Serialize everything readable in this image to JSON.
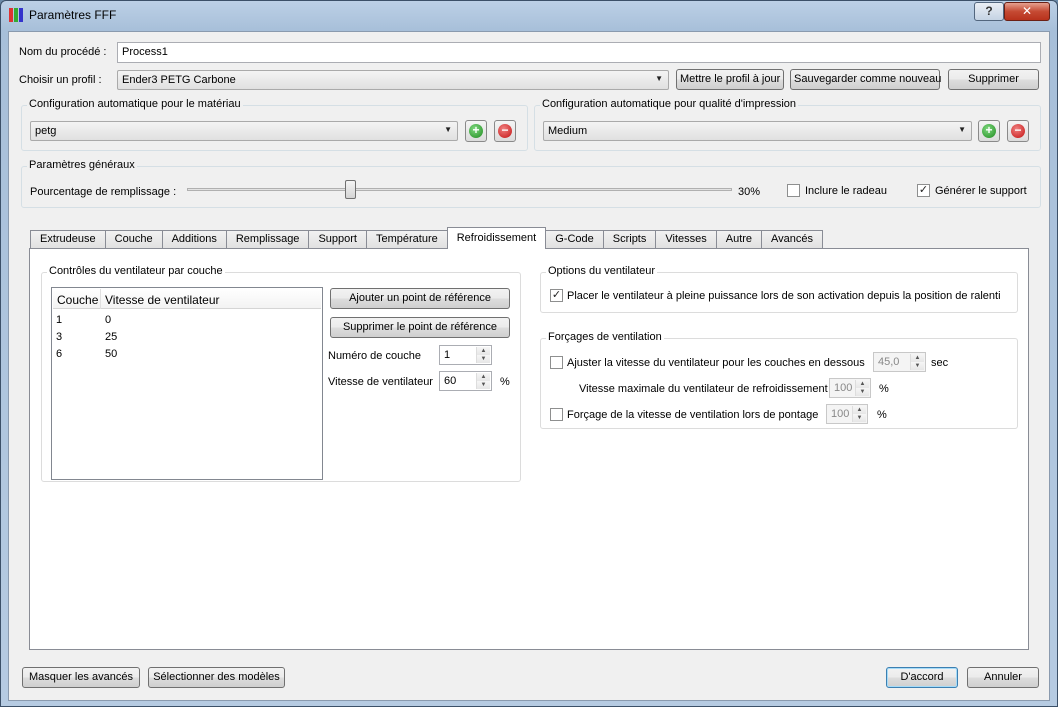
{
  "window": {
    "title": "Paramètres FFF",
    "help_label": "?",
    "close_label": "✕"
  },
  "process": {
    "name_label": "Nom du procédé :",
    "name_value": "Process1"
  },
  "profile": {
    "label": "Choisir un profil :",
    "selected": "Ender3 PETG Carbone",
    "update_btn": "Mettre le profil à jour",
    "save_new_btn": "Sauvegarder comme nouveau",
    "delete_btn": "Supprimer"
  },
  "auto_material": {
    "title": "Configuration automatique pour le matériau",
    "selected": "petg"
  },
  "auto_quality": {
    "title": "Configuration automatique pour qualité d'impression",
    "selected": "Medium"
  },
  "general": {
    "title": "Paramètres généraux",
    "infill_label": "Pourcentage de remplissage :",
    "infill_value_text": "30%",
    "infill_fraction": 0.3,
    "raft_label": "Inclure le radeau",
    "raft_checked": false,
    "support_label": "Générer le support",
    "support_checked": true
  },
  "tabs": [
    "Extrudeuse",
    "Couche",
    "Additions",
    "Remplissage",
    "Support",
    "Température",
    "Refroidissement",
    "G-Code",
    "Scripts",
    "Vitesses",
    "Autre",
    "Avancés"
  ],
  "active_tab": "Refroidissement",
  "fan_controls": {
    "title": "Contrôles du ventilateur par couche",
    "col_layer": "Couche",
    "col_speed": "Vitesse de ventilateur",
    "rows": [
      {
        "layer": "1",
        "speed": "0"
      },
      {
        "layer": "3",
        "speed": "25"
      },
      {
        "layer": "6",
        "speed": "50"
      }
    ],
    "add_btn": "Ajouter un point de référence",
    "remove_btn": "Supprimer le point de référence",
    "layer_num_label": "Numéro de couche",
    "layer_num_value": "1",
    "fan_speed_label": "Vitesse de ventilateur",
    "fan_speed_value": "60",
    "percent_unit": "%"
  },
  "fan_options": {
    "title": "Options du ventilateur",
    "full_power_label": "Placer le ventilateur à pleine puissance lors de son activation depuis la position de ralenti",
    "full_power_checked": true
  },
  "fan_overrides": {
    "title": "Forçages de ventilation",
    "adjust_label": "Ajuster la vitesse du ventilateur pour les couches en dessous",
    "adjust_checked": false,
    "adjust_value": "45,0",
    "adjust_unit": "sec",
    "max_speed_label": "Vitesse maximale du ventilateur de refroidissement",
    "max_speed_value": "100",
    "max_speed_unit": "%",
    "bridge_label": "Forçage de la vitesse de ventilation lors de pontage",
    "bridge_checked": false,
    "bridge_value": "100",
    "bridge_unit": "%"
  },
  "footer": {
    "hide_advanced_btn": "Masquer les avancés",
    "select_models_btn": "Sélectionner des modèles",
    "ok_btn": "D'accord",
    "cancel_btn": "Annuler"
  },
  "colors": {
    "title_gradient_top": "#bcd0e6",
    "dialog_bg": "#f0f0f0",
    "plus_green": "#1f8a1f",
    "minus_red": "#c41313"
  },
  "icons": {
    "app": "simplify3d-bars-icon",
    "add": "plus-circle-icon",
    "remove": "minus-circle-icon",
    "dropdown": "chevron-down-icon"
  }
}
